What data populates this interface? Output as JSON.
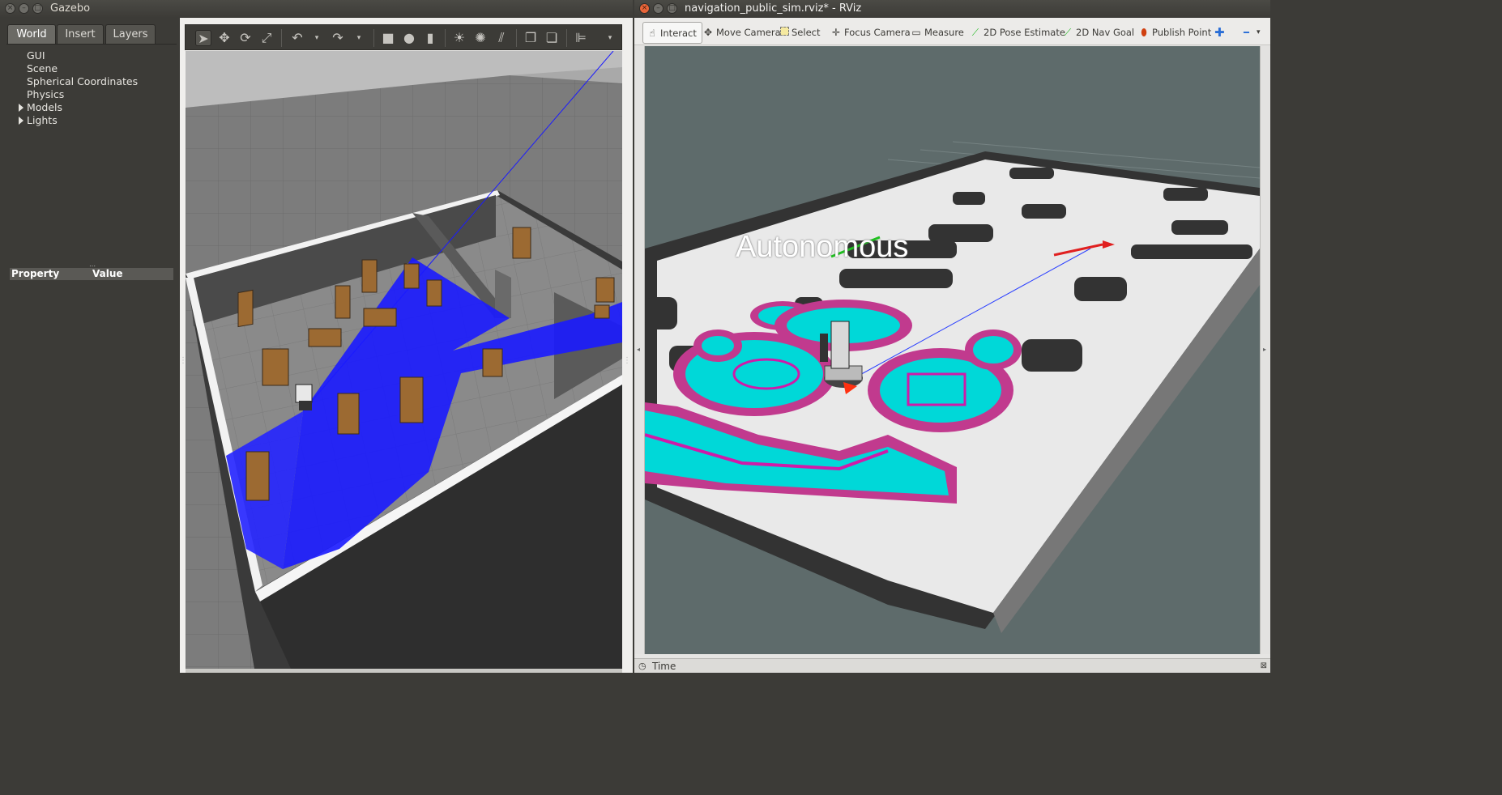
{
  "gazebo": {
    "window_title": "Gazebo",
    "tabs": [
      "World",
      "Insert",
      "Layers"
    ],
    "tree": [
      {
        "label": "GUI",
        "expandable": false
      },
      {
        "label": "Scene",
        "expandable": false
      },
      {
        "label": "Spherical Coordinates",
        "expandable": false
      },
      {
        "label": "Physics",
        "expandable": false
      },
      {
        "label": "Models",
        "expandable": true
      },
      {
        "label": "Lights",
        "expandable": true
      }
    ],
    "property_header": {
      "col1": "Property",
      "col2": "Value"
    },
    "toolbar_icons": [
      "select-arrow-icon",
      "translate-icon",
      "rotate-icon",
      "scale-icon",
      "undo-icon",
      "undo-dropdown-icon",
      "redo-icon",
      "redo-dropdown-icon",
      "box-icon",
      "sphere-icon",
      "cylinder-icon",
      "sun-light-icon",
      "point-light-icon",
      "directional-light-icon",
      "copy-icon",
      "paste-icon",
      "align-icon",
      "toolbar-more-icon"
    ]
  },
  "rviz": {
    "window_title": "navigation_public_sim.rviz* - RViz",
    "tools": [
      {
        "label": "Interact",
        "icon": "hand-icon"
      },
      {
        "label": "Move Camera",
        "icon": "move-camera-icon"
      },
      {
        "label": "Select",
        "icon": "select-box-icon"
      },
      {
        "label": "Focus Camera",
        "icon": "focus-camera-icon"
      },
      {
        "label": "Measure",
        "icon": "ruler-icon"
      },
      {
        "label": "2D Pose Estimate",
        "icon": "pose-arrow-icon"
      },
      {
        "label": "2D Nav Goal",
        "icon": "nav-goal-arrow-icon"
      },
      {
        "label": "Publish Point",
        "icon": "map-pin-icon"
      }
    ],
    "overlay_text": "Autonomous",
    "time_panel": "Time",
    "colors": {
      "costmap_cyan": "#00d8d8",
      "costmap_magenta": "#d01aa8",
      "laser_blue": "#1818ff",
      "background": "#5e6b6b"
    }
  }
}
